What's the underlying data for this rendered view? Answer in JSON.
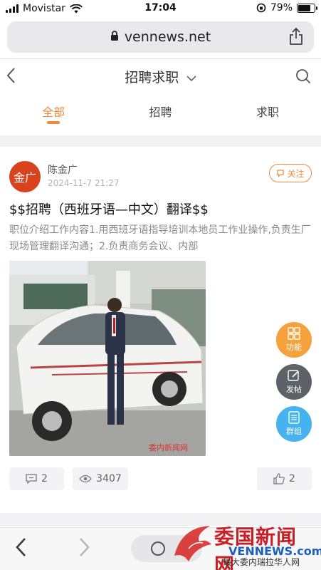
{
  "status": {
    "carrier": "Movistar",
    "time": "17:04",
    "battery": "79%",
    "battery_level": 0.79
  },
  "browser": {
    "url": "vennews.net"
  },
  "header": {
    "back_icon": "chevron-left-icon",
    "title": "招聘求职",
    "search_icon": "search-icon"
  },
  "tabs": [
    {
      "label": "全部",
      "active": true
    },
    {
      "label": "招聘",
      "active": false
    },
    {
      "label": "求职",
      "active": false
    }
  ],
  "post": {
    "avatar_text": "金广",
    "author": "陈金广",
    "time": "2024-11-7 21:27",
    "follow_label": "关注",
    "title": "$$招聘（西班牙语—中文）翻译$$",
    "body": "职位介绍工作内容1.用西班牙语指导培训本地员工作业操作,负责生厂现场管理翻译沟通；2.负责商务会议、内部",
    "photo_watermark": "委内新闻网",
    "comments": "2",
    "views": "3407",
    "likes": "2"
  },
  "fab": [
    {
      "label": "功能",
      "color": "#f5a13c"
    },
    {
      "label": "发帖",
      "color": "#5d6269"
    },
    {
      "label": "群组",
      "color": "#44b3ef"
    }
  ],
  "watermark": {
    "main": "委国新闻网",
    "sub": "VENNEWS.com",
    "tagline": "最大委内瑞拉华人网"
  },
  "colors": {
    "accent": "#f08a3c",
    "avatar": "#d8421c"
  }
}
